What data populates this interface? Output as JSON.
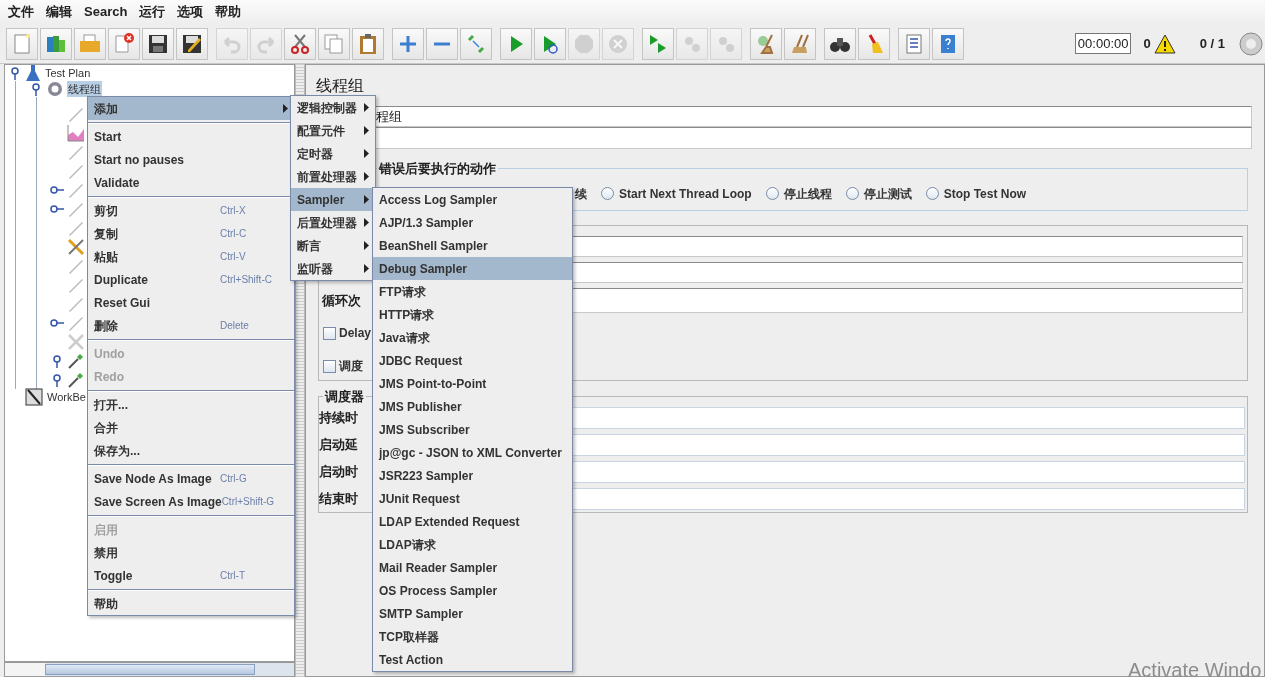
{
  "menu_bar": [
    "文件",
    "编辑",
    "Search",
    "运行",
    "选项",
    "帮助"
  ],
  "toolbar": {
    "groups": [
      [
        {
          "kind": "new",
          "disabled": false
        },
        {
          "kind": "templates",
          "disabled": false
        },
        {
          "kind": "open",
          "disabled": false
        },
        {
          "kind": "close",
          "disabled": false
        },
        {
          "kind": "save",
          "disabled": false
        },
        {
          "kind": "save_as",
          "disabled": false
        }
      ],
      [
        {
          "kind": "undo",
          "disabled": true
        },
        {
          "kind": "redo",
          "disabled": true
        },
        {
          "kind": "cut",
          "disabled": false
        },
        {
          "kind": "copy",
          "disabled": false
        },
        {
          "kind": "paste",
          "disabled": false
        }
      ],
      [
        {
          "kind": "expand",
          "disabled": false
        },
        {
          "kind": "collapse",
          "disabled": false
        },
        {
          "kind": "toggle",
          "disabled": false
        }
      ],
      [
        {
          "kind": "start",
          "disabled": false
        },
        {
          "kind": "start_no_pause",
          "disabled": false
        },
        {
          "kind": "stop",
          "disabled": true
        },
        {
          "kind": "shutdown",
          "disabled": true
        }
      ],
      [
        {
          "kind": "remote_start",
          "disabled": false
        },
        {
          "kind": "remote_stop",
          "disabled": true
        },
        {
          "kind": "remote_shutdown",
          "disabled": true
        }
      ],
      [
        {
          "kind": "clear",
          "disabled": false
        },
        {
          "kind": "clear_all",
          "disabled": false
        }
      ],
      [
        {
          "kind": "search",
          "disabled": false
        },
        {
          "kind": "reset_search",
          "disabled": false
        }
      ],
      [
        {
          "kind": "function_helper",
          "disabled": false
        },
        {
          "kind": "help",
          "disabled": false
        }
      ]
    ],
    "timer": "00:00:00",
    "warnings": "0",
    "threads": "0 / 1"
  },
  "tree": [
    {
      "label": "Test Plan",
      "kind": "plan",
      "selected": false,
      "expanded": true,
      "children": [
        {
          "label": "线程组",
          "kind": "gear",
          "selected": true,
          "expanded": true,
          "children": [
            {
              "kind": "pencil"
            },
            {
              "kind": "chart"
            },
            {
              "kind": "pencil"
            },
            {
              "kind": "pencil"
            },
            {
              "kind": "pencil",
              "expanded": false
            },
            {
              "kind": "pencil",
              "expanded": false
            },
            {
              "kind": "pencil"
            },
            {
              "kind": "tools"
            },
            {
              "kind": "pencil"
            },
            {
              "kind": "pencil"
            },
            {
              "kind": "pencil"
            },
            {
              "kind": "pencil",
              "expanded": false
            },
            {
              "kind": "tools_disabled"
            },
            {
              "kind": "pipette",
              "expanded": true
            },
            {
              "kind": "pipette",
              "expanded": true
            }
          ]
        }
      ]
    },
    {
      "label": "WorkBe",
      "kind": "workbench",
      "selected": false
    }
  ],
  "context_menu": [
    {
      "kind": "submenu",
      "label": "添加",
      "selected": true,
      "disabled": false
    },
    {
      "kind": "separator"
    },
    {
      "kind": "item",
      "label": "Start",
      "selected": false,
      "disabled": false
    },
    {
      "kind": "item",
      "label": "Start no pauses",
      "selected": false,
      "disabled": false
    },
    {
      "kind": "item",
      "label": "Validate",
      "selected": false,
      "disabled": false
    },
    {
      "kind": "separator"
    },
    {
      "kind": "item",
      "label": "剪切",
      "shortcut": "Ctrl-X",
      "selected": false,
      "disabled": false
    },
    {
      "kind": "item",
      "label": "复制",
      "shortcut": "Ctrl-C",
      "selected": false,
      "disabled": false
    },
    {
      "kind": "item",
      "label": "粘贴",
      "shortcut": "Ctrl-V",
      "selected": false,
      "disabled": false
    },
    {
      "kind": "item",
      "label": "Duplicate",
      "shortcut": "Ctrl+Shift-C",
      "selected": false,
      "disabled": false
    },
    {
      "kind": "item",
      "label": "Reset Gui",
      "selected": false,
      "disabled": false
    },
    {
      "kind": "item",
      "label": "删除",
      "shortcut": "Delete",
      "selected": false,
      "disabled": false
    },
    {
      "kind": "separator"
    },
    {
      "kind": "item",
      "label": "Undo",
      "selected": false,
      "disabled": true
    },
    {
      "kind": "item",
      "label": "Redo",
      "selected": false,
      "disabled": true
    },
    {
      "kind": "separator"
    },
    {
      "kind": "item",
      "label": "打开...",
      "selected": false,
      "disabled": false
    },
    {
      "kind": "item",
      "label": "合并",
      "selected": false,
      "disabled": false
    },
    {
      "kind": "item",
      "label": "保存为...",
      "selected": false,
      "disabled": false
    },
    {
      "kind": "separator"
    },
    {
      "kind": "item",
      "label": "Save Node As Image",
      "shortcut": "Ctrl-G",
      "selected": false,
      "disabled": false
    },
    {
      "kind": "item",
      "label": "Save Screen As Image",
      "shortcut": "Ctrl+Shift-G",
      "selected": false,
      "disabled": false
    },
    {
      "kind": "separator"
    },
    {
      "kind": "item",
      "label": "启用",
      "selected": false,
      "disabled": true
    },
    {
      "kind": "item",
      "label": "禁用",
      "selected": false,
      "disabled": false
    },
    {
      "kind": "item",
      "label": "Toggle",
      "shortcut": "Ctrl-T",
      "selected": false,
      "disabled": false
    },
    {
      "kind": "separator"
    },
    {
      "kind": "item",
      "label": "帮助",
      "selected": false,
      "disabled": false
    }
  ],
  "add_submenu": [
    {
      "kind": "submenu",
      "label": "逻辑控制器",
      "selected": false
    },
    {
      "kind": "submenu",
      "label": "配置元件",
      "selected": false
    },
    {
      "kind": "submenu",
      "label": "定时器",
      "selected": false
    },
    {
      "kind": "submenu",
      "label": "前置处理器",
      "selected": false
    },
    {
      "kind": "submenu",
      "label": "Sampler",
      "selected": true
    },
    {
      "kind": "submenu",
      "label": "后置处理器",
      "selected": false
    },
    {
      "kind": "submenu",
      "label": "断言",
      "selected": false
    },
    {
      "kind": "submenu",
      "label": "监听器",
      "selected": false
    }
  ],
  "sampler_submenu": [
    {
      "label": "Access Log Sampler",
      "selected": false
    },
    {
      "label": "AJP/1.3 Sampler",
      "selected": false
    },
    {
      "label": "BeanShell Sampler",
      "selected": false
    },
    {
      "label": "Debug Sampler",
      "selected": true
    },
    {
      "label": "FTP请求",
      "selected": false
    },
    {
      "label": "HTTP请求",
      "selected": false
    },
    {
      "label": "Java请求",
      "selected": false
    },
    {
      "label": "JDBC Request",
      "selected": false
    },
    {
      "label": "JMS Point-to-Point",
      "selected": false
    },
    {
      "label": "JMS Publisher",
      "selected": false
    },
    {
      "label": "JMS Subscriber",
      "selected": false
    },
    {
      "label": "jp@gc - JSON to XML Converter",
      "selected": false
    },
    {
      "label": "JSR223 Sampler",
      "selected": false
    },
    {
      "label": "JUnit Request",
      "selected": false
    },
    {
      "label": "LDAP Extended Request",
      "selected": false
    },
    {
      "label": "LDAP请求",
      "selected": false
    },
    {
      "label": "Mail Reader Sampler",
      "selected": false
    },
    {
      "label": "OS Process Sampler",
      "selected": false
    },
    {
      "label": "SMTP Sampler",
      "selected": false
    },
    {
      "label": "TCP取样器",
      "selected": false
    },
    {
      "label": "Test Action",
      "selected": false
    }
  ],
  "thread_group": {
    "title": "线程组",
    "name_value": "程组",
    "error_action": {
      "legend": "错误后要执行的动作",
      "partial_label": "续",
      "options": [
        {
          "label": "Start Next Thread Loop",
          "selected": false
        },
        {
          "label": "停止线程",
          "selected": false
        },
        {
          "label": "停止测试",
          "selected": false
        },
        {
          "label": "Stop Test Now",
          "selected": false
        }
      ]
    },
    "thread_properties": {
      "loop_label": "循环次",
      "checkboxes": [
        {
          "label": "Delay",
          "checked": false
        },
        {
          "label": "调度",
          "checked": false
        }
      ]
    },
    "scheduler": {
      "legend": "调度器",
      "field_labels": [
        "持续时",
        "启动延",
        "启动时",
        "结束时"
      ]
    }
  },
  "os_notice": "Activate Windo"
}
